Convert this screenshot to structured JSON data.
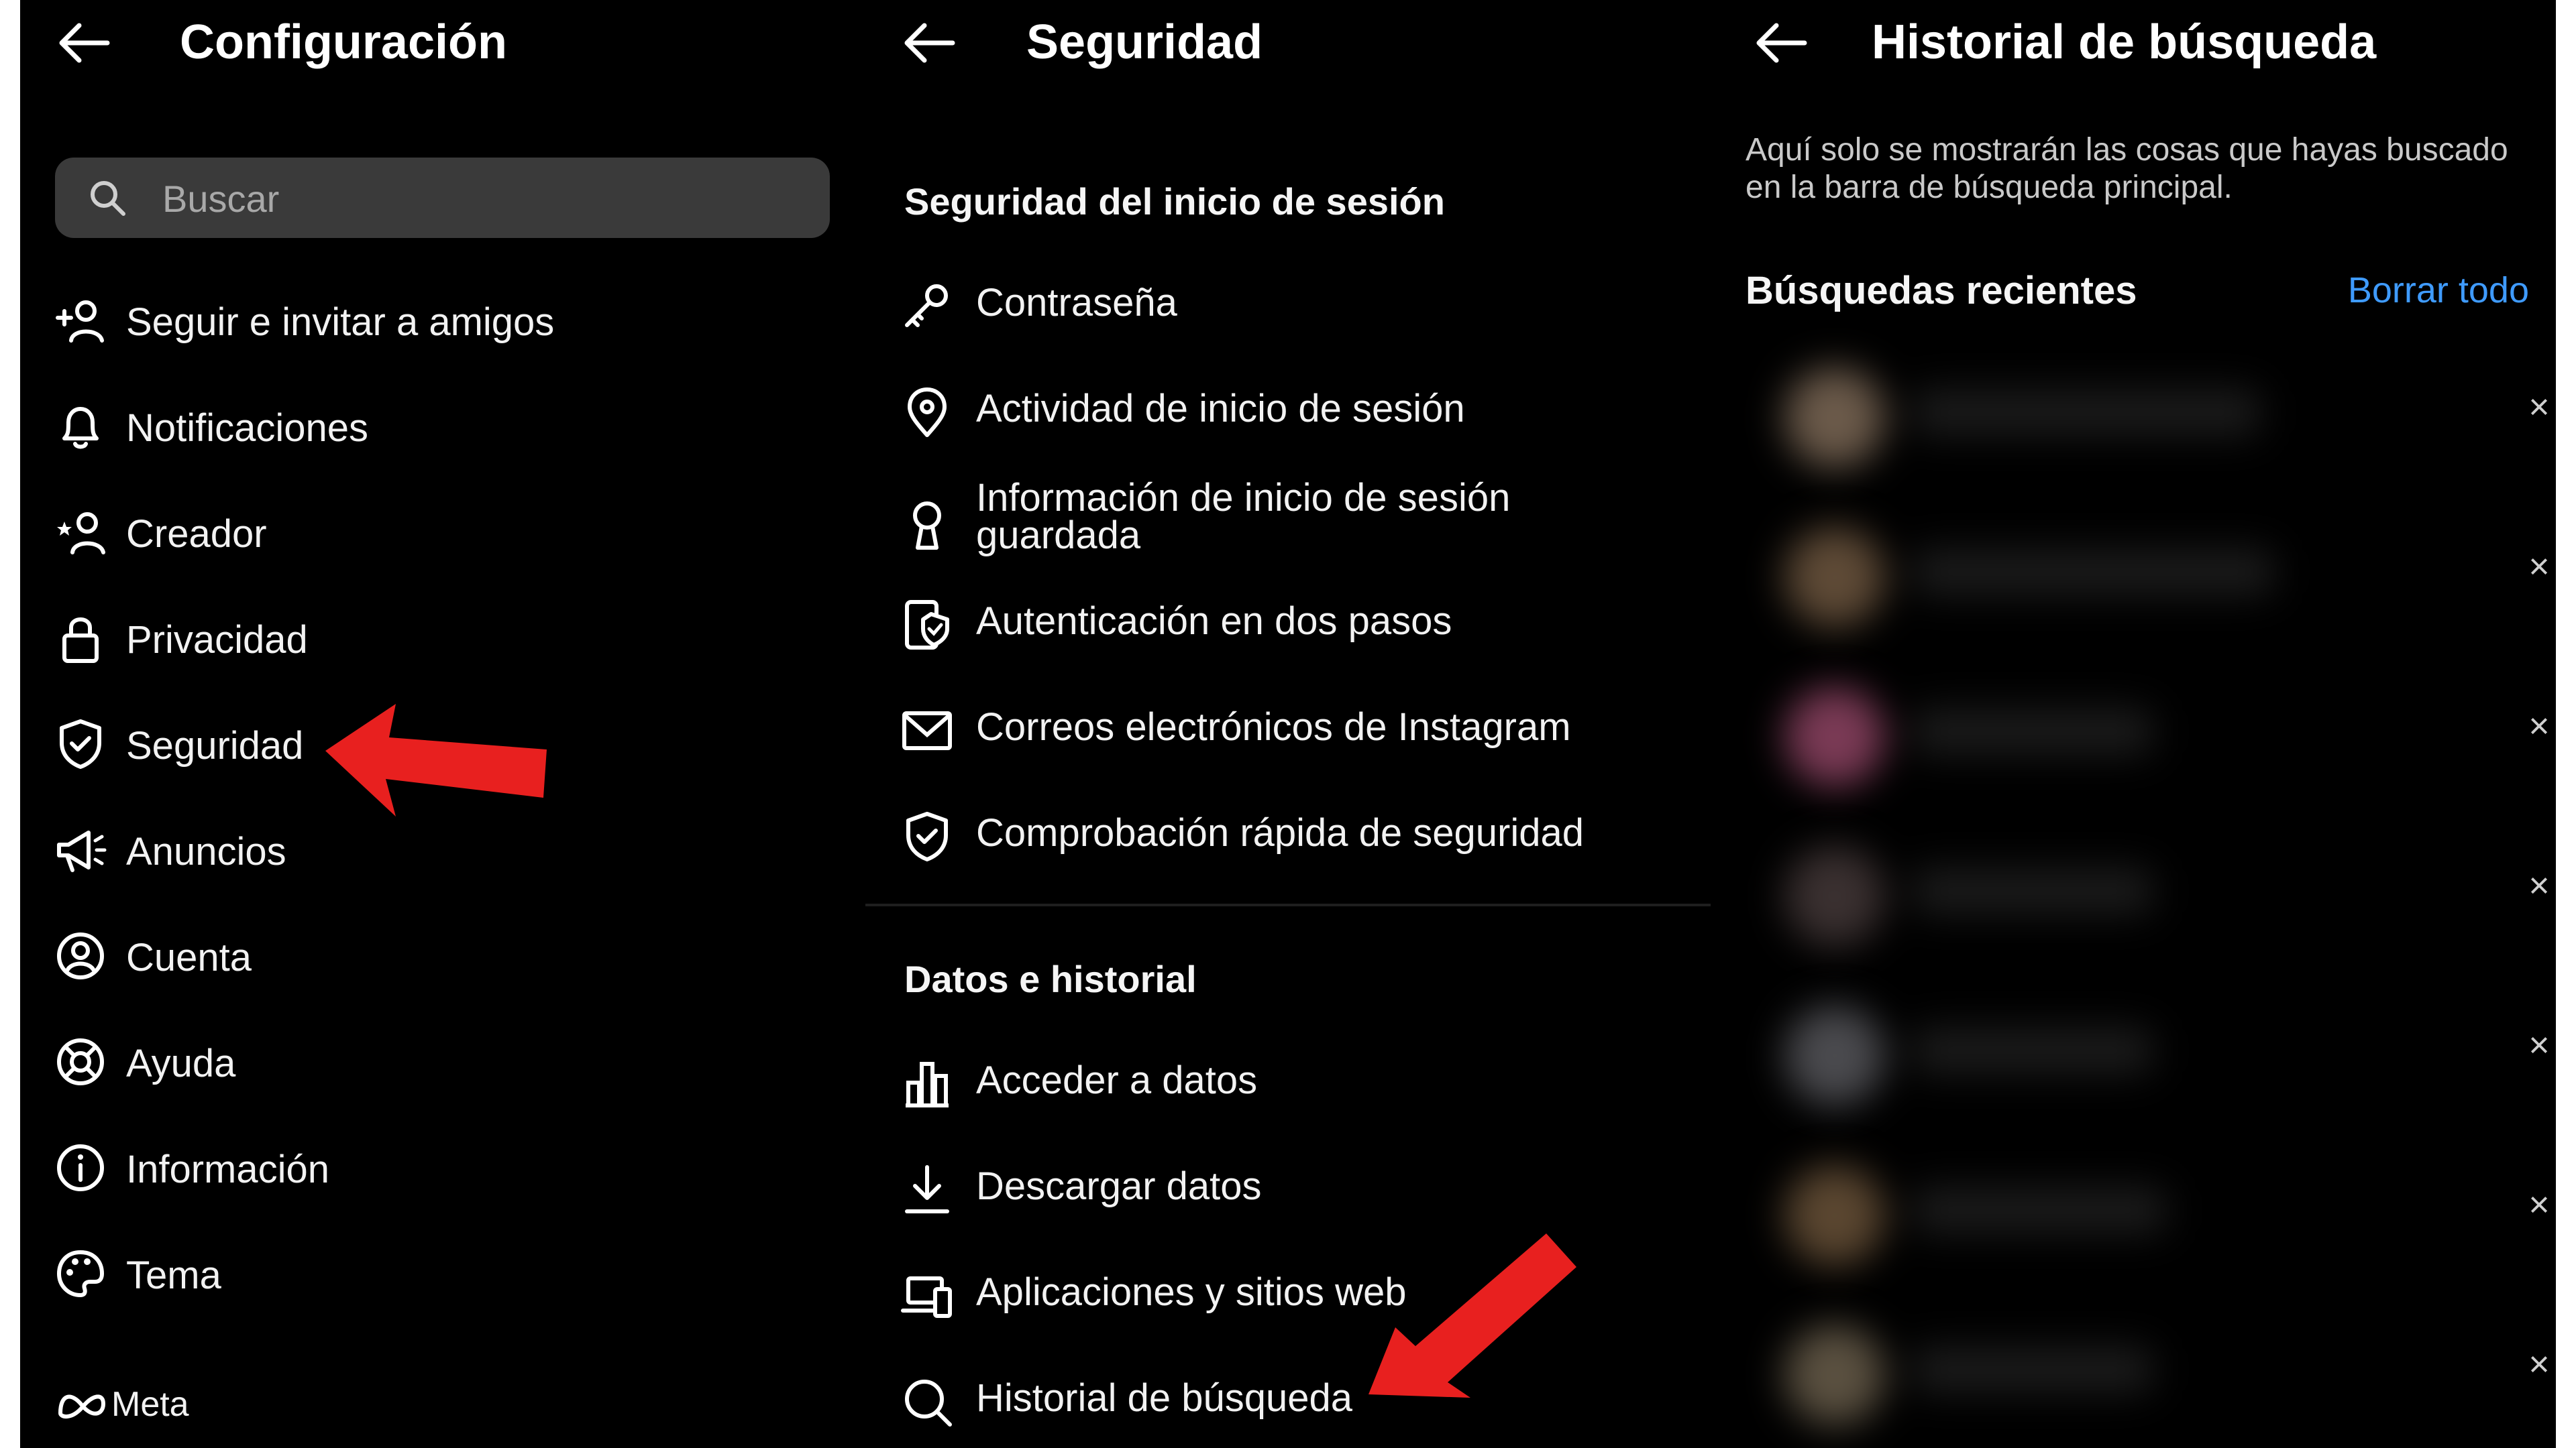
{
  "colors": {
    "background": "#000000",
    "text": "#f2f2f2",
    "search_bg": "#3a3a3a",
    "link_blue": "#3f9bff",
    "annotation_arrow": "#e8201f"
  },
  "panel_settings": {
    "title": "Configuración",
    "back_icon": "arrow-left-icon",
    "search": {
      "placeholder": "Buscar",
      "icon": "search-icon"
    },
    "items": [
      {
        "label": "Seguir e invitar a amigos",
        "icon": "add-person-icon"
      },
      {
        "label": "Notificaciones",
        "icon": "bell-icon"
      },
      {
        "label": "Creador",
        "icon": "star-person-icon"
      },
      {
        "label": "Privacidad",
        "icon": "lock-icon"
      },
      {
        "label": "Seguridad",
        "icon": "shield-icon"
      },
      {
        "label": "Anuncios",
        "icon": "megaphone-icon"
      },
      {
        "label": "Cuenta",
        "icon": "account-circle-icon"
      },
      {
        "label": "Ayuda",
        "icon": "lifebuoy-icon"
      },
      {
        "label": "Información",
        "icon": "info-icon"
      },
      {
        "label": "Tema",
        "icon": "palette-icon"
      }
    ],
    "footer_brand": "Meta"
  },
  "panel_security": {
    "title": "Seguridad",
    "back_icon": "arrow-left-icon",
    "sections": [
      {
        "heading": "Seguridad del inicio de sesión",
        "items": [
          {
            "label": "Contraseña",
            "icon": "key-icon"
          },
          {
            "label": "Actividad de inicio de sesión",
            "icon": "location-pin-icon"
          },
          {
            "label": "Información de inicio de sesión guardada",
            "icon": "keyhole-icon"
          },
          {
            "label": "Autenticación en dos pasos",
            "icon": "phone-shield-icon"
          },
          {
            "label": "Correos electrónicos de Instagram",
            "icon": "envelope-icon"
          },
          {
            "label": "Comprobación rápida de seguridad",
            "icon": "shield-check-icon"
          }
        ]
      },
      {
        "heading": "Datos e historial",
        "items": [
          {
            "label": "Acceder a datos",
            "icon": "bar-chart-icon"
          },
          {
            "label": "Descargar datos",
            "icon": "download-icon"
          },
          {
            "label": "Aplicaciones y sitios web",
            "icon": "devices-icon"
          },
          {
            "label": "Historial de búsqueda",
            "icon": "search-icon"
          }
        ]
      }
    ]
  },
  "panel_history": {
    "title": "Historial de búsqueda",
    "back_icon": "arrow-left-icon",
    "description": "Aquí solo se mostrarán las cosas que hayas buscado en la barra de búsqueda principal.",
    "recent_heading": "Búsquedas recientes",
    "clear_all": "Borrar todo",
    "remove_glyph": "×",
    "blurred_results": [
      {
        "avatar_color": "#6b5a4a"
      },
      {
        "avatar_color": "#5e4a36"
      },
      {
        "avatar_color": "#7a3a55"
      },
      {
        "avatar_color": "#3a3030"
      },
      {
        "avatar_color": "#4a4a4e"
      },
      {
        "avatar_color": "#5a4630"
      },
      {
        "avatar_color": "#5a5040"
      }
    ]
  }
}
